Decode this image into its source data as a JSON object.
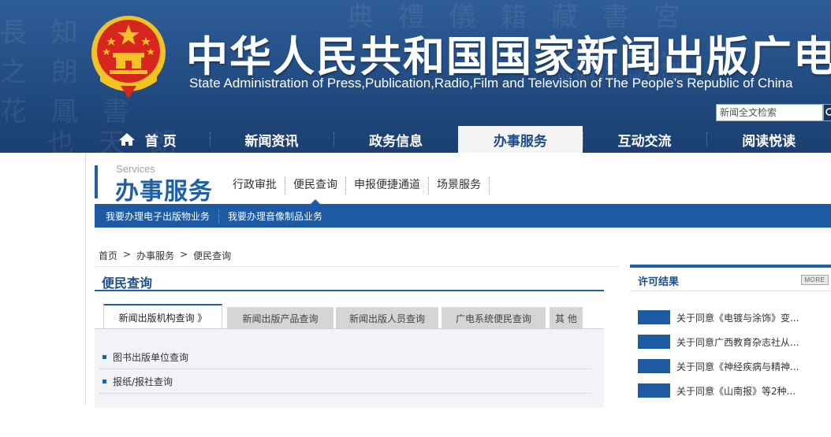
{
  "header": {
    "title_cn": "中华人民共和国国家新闻出版广电总局",
    "title_en": "State Administration of Press,Publication,Radio,Film and Television of The People’s Republic of China",
    "search_placeholder": "新闻全文检索"
  },
  "nav": {
    "items": [
      {
        "label": "首 页",
        "icon": "home-icon"
      },
      {
        "label": "新闻资讯"
      },
      {
        "label": "政务信息"
      },
      {
        "label": "办事服务",
        "active": true
      },
      {
        "label": "互动交流"
      },
      {
        "label": "阅读悦读"
      }
    ]
  },
  "section": {
    "en": "Services",
    "cn": "办事服务",
    "subnav": [
      "行政审批",
      "便民查询",
      "申报便捷通道",
      "场景服务"
    ],
    "active_subnav": "便民查询",
    "biz_links": [
      "我要办理电子出版物业务",
      "我要办理音像制品业务"
    ]
  },
  "breadcrumb": {
    "items": [
      "首页",
      ">",
      "办事服务",
      ">",
      "便民查询"
    ]
  },
  "panel": {
    "title": "便民查询",
    "tabs": [
      "新闻出版机构查询 》",
      "新闻出版产品查询",
      "新闻出版人员查询",
      "广电系统便民查询",
      "其 他"
    ],
    "active_tab": 0,
    "items": [
      "图书出版单位查询",
      "报纸/报社查询"
    ]
  },
  "right": {
    "title": "许可结果",
    "more": "MORE",
    "news": [
      "关于同意《电镀与涂饰》变...",
      "关于同意广西教育杂志社从...",
      "关于同意《神经疾病与精神...",
      "关于同意《山南报》等2种..."
    ]
  },
  "colors": {
    "brand_blue": "#1f5fa8",
    "banner_blue": "#244f86",
    "emblem_red": "#d7261d",
    "emblem_gold": "#f3c325"
  }
}
